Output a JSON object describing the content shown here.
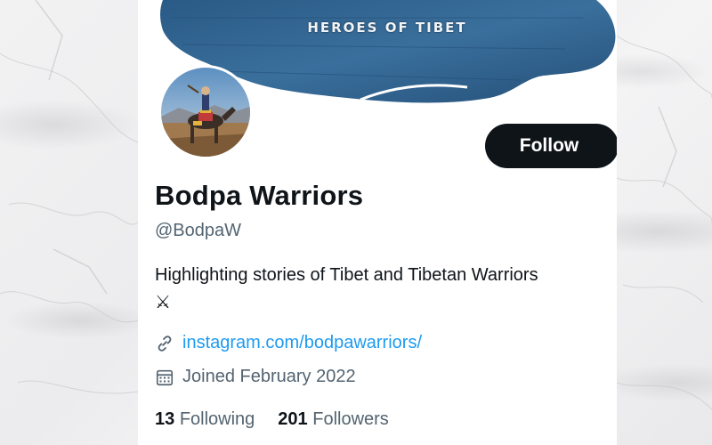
{
  "banner": {
    "title": "HEROES OF TIBET",
    "color": "#2f5f8c"
  },
  "profile": {
    "display_name": "Bodpa Warriors",
    "handle": "@BodpaW",
    "bio": "Highlighting stories of Tibet and Tibetan Warriors",
    "bio_emoji": "⚔",
    "link": "instagram.com/bodpawarriors/",
    "joined": "Joined February 2022",
    "avatar_icon": "horse-rider-photo"
  },
  "actions": {
    "follow_label": "Follow"
  },
  "stats": {
    "following_count": "13",
    "following_label": "Following",
    "followers_count": "201",
    "followers_label": "Followers"
  },
  "icons": {
    "link": "link-icon",
    "calendar": "calendar-icon"
  },
  "colors": {
    "accent": "#1d9bf0",
    "text_primary": "#0f1419",
    "text_secondary": "#536471",
    "button_bg": "#0f1419"
  }
}
